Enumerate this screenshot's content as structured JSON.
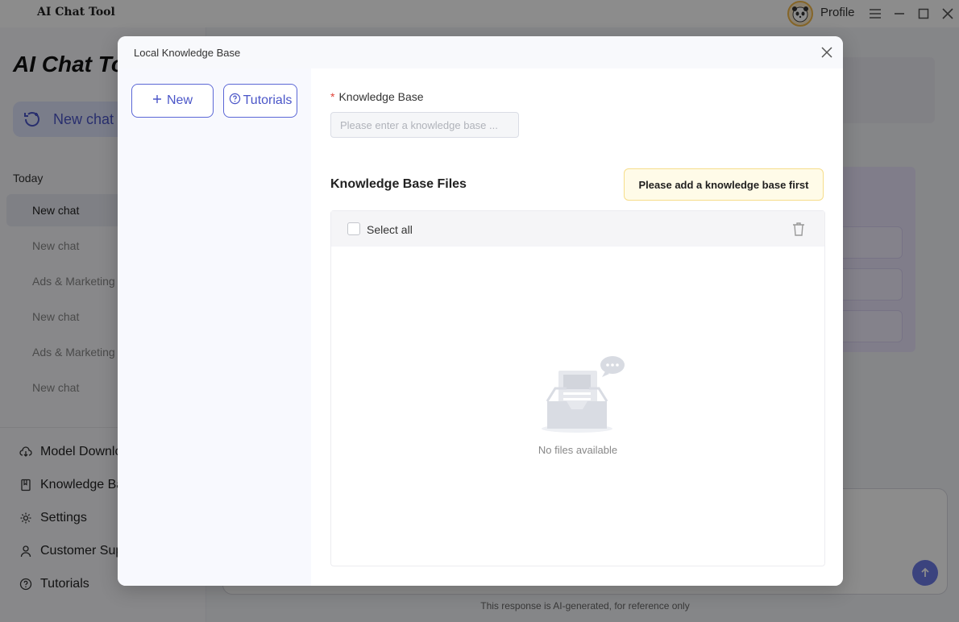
{
  "app": {
    "name": "AI Chat Tool",
    "profile_label": "Profile"
  },
  "sidebar": {
    "big_title": "AI Chat Tool",
    "new_chat": "New chat",
    "section": "Today",
    "chats": [
      {
        "label": "New chat",
        "active": true
      },
      {
        "label": "New chat",
        "active": false
      },
      {
        "label": "Ads & Marketing",
        "active": false
      },
      {
        "label": "New chat",
        "active": false
      },
      {
        "label": "Ads & Marketing",
        "active": false
      },
      {
        "label": "New chat",
        "active": false
      }
    ],
    "links": [
      {
        "label": "Model Downloads",
        "icon": "cloud-download-icon"
      },
      {
        "label": "Knowledge Base",
        "icon": "book-icon"
      },
      {
        "label": "Settings",
        "icon": "gear-icon"
      },
      {
        "label": "Customer Support",
        "icon": "user-icon"
      },
      {
        "label": "Tutorials",
        "icon": "help-circle-icon"
      }
    ]
  },
  "main": {
    "disclaimer": "This response is AI-generated, for reference only"
  },
  "modal": {
    "title": "Local Knowledge Base",
    "new_button": "New",
    "tutorials_button": "Tutorials",
    "kb_label": "Knowledge Base",
    "kb_required_mark": "*",
    "kb_placeholder": "Please enter a knowledge base ...",
    "files_title": "Knowledge Base Files",
    "notice": "Please add a knowledge base first",
    "select_all": "Select all",
    "empty_text": "No files available"
  },
  "colors": {
    "accent": "#4b56c8",
    "notice_bg": "#fffbe8",
    "required": "#e0443a"
  }
}
